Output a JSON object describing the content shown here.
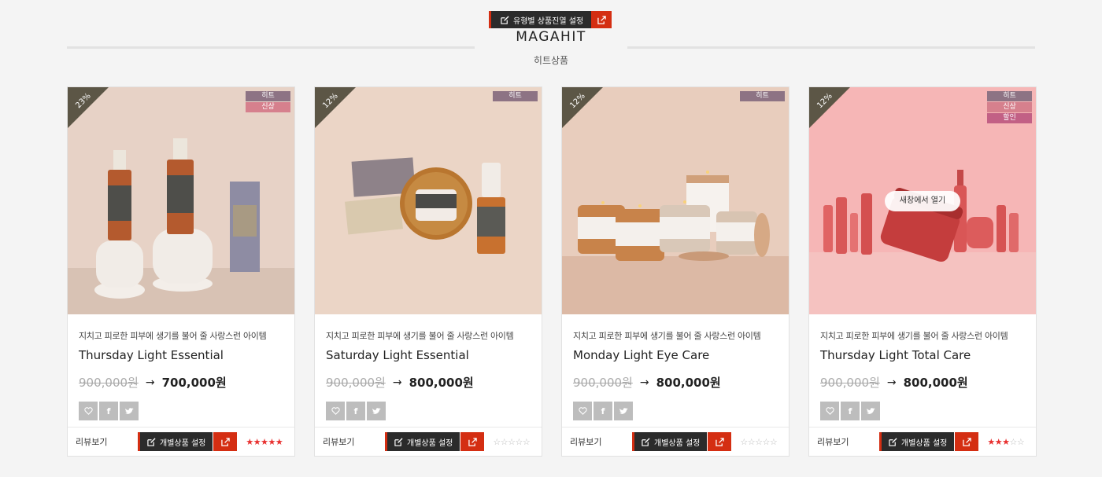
{
  "top_admin": {
    "label": "유형별 상품진열 설정"
  },
  "section": {
    "title": "MAGAHIT",
    "subtitle": "히트상품"
  },
  "products": [
    {
      "discount": "23%",
      "tags": [
        "히트",
        "신상"
      ],
      "desc": "지치고 피로한 피부에 생기를 불어 줄 사랑스런 아이템",
      "name": "Thursday Light Essential",
      "old_price": "900,000원",
      "new_price": "700,000원",
      "rating": 5,
      "review_label": "리뷰보기",
      "admin_label": "개별상품 설정"
    },
    {
      "discount": "12%",
      "tags": [
        "히트"
      ],
      "desc": "지치고 피로한 피부에 생기를 불어 줄 사랑스런 아이템",
      "name": "Saturday Light Essential",
      "old_price": "900,000원",
      "new_price": "800,000원",
      "rating": 0,
      "review_label": "리뷰보기",
      "admin_label": "개별상품 설정"
    },
    {
      "discount": "12%",
      "tags": [
        "히트"
      ],
      "desc": "지치고 피로한 피부에 생기를 불어 줄 사랑스런 아이템",
      "name": "Monday Light Eye Care",
      "old_price": "900,000원",
      "new_price": "800,000원",
      "rating": 0,
      "review_label": "리뷰보기",
      "admin_label": "개별상품 설정"
    },
    {
      "discount": "12%",
      "tags": [
        "히트",
        "신상",
        "할인"
      ],
      "desc": "지치고 피로한 피부에 생기를 불어 줄 사랑스런 아이템",
      "name": "Thursday Light Total Care",
      "old_price": "900,000원",
      "new_price": "800,000원",
      "rating": 3,
      "review_label": "리뷰보기",
      "admin_label": "개별상품 설정",
      "hover_label": "새창에서 열기"
    }
  ],
  "colors": {
    "accent": "#d42e12",
    "dark": "#2b2b2b",
    "ribbon": "#5c5646",
    "star": "#e8302f"
  }
}
